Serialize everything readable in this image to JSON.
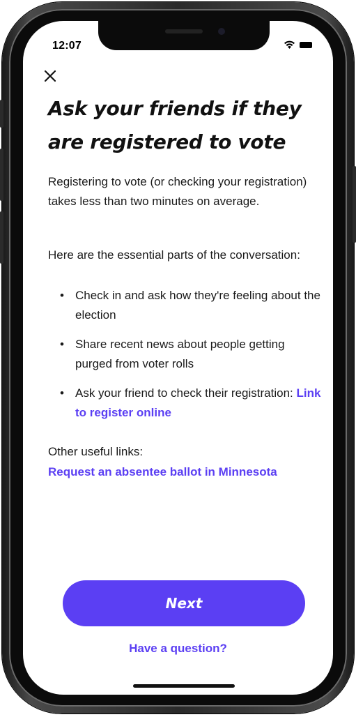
{
  "status_bar": {
    "time": "12:07",
    "icons": [
      "wifi-icon",
      "battery-icon"
    ]
  },
  "header": {
    "close_icon": "close-icon",
    "title": "Ask your friends if they are registered to vote"
  },
  "content": {
    "intro": "Registering to vote (or checking your registration) takes less than two minutes on average.",
    "essential_label": "Here are the essential parts of the conversation:",
    "bullets": [
      {
        "text": "Check in and ask how they're feeling about the election"
      },
      {
        "text": "Share recent news about people getting purged from voter rolls"
      },
      {
        "text": "Ask your friend to check their registration: ",
        "link": "Link to register online"
      }
    ],
    "bullet_symbol": "•",
    "other_links_label": "Other useful links:",
    "absentee_link": "Request an absentee ballot in Minnesota"
  },
  "footer": {
    "next_label": "Next",
    "question_link": "Have a question?"
  },
  "colors": {
    "accent": "#5b3ff3",
    "text": "#1a1a1a",
    "background": "#ffffff"
  }
}
